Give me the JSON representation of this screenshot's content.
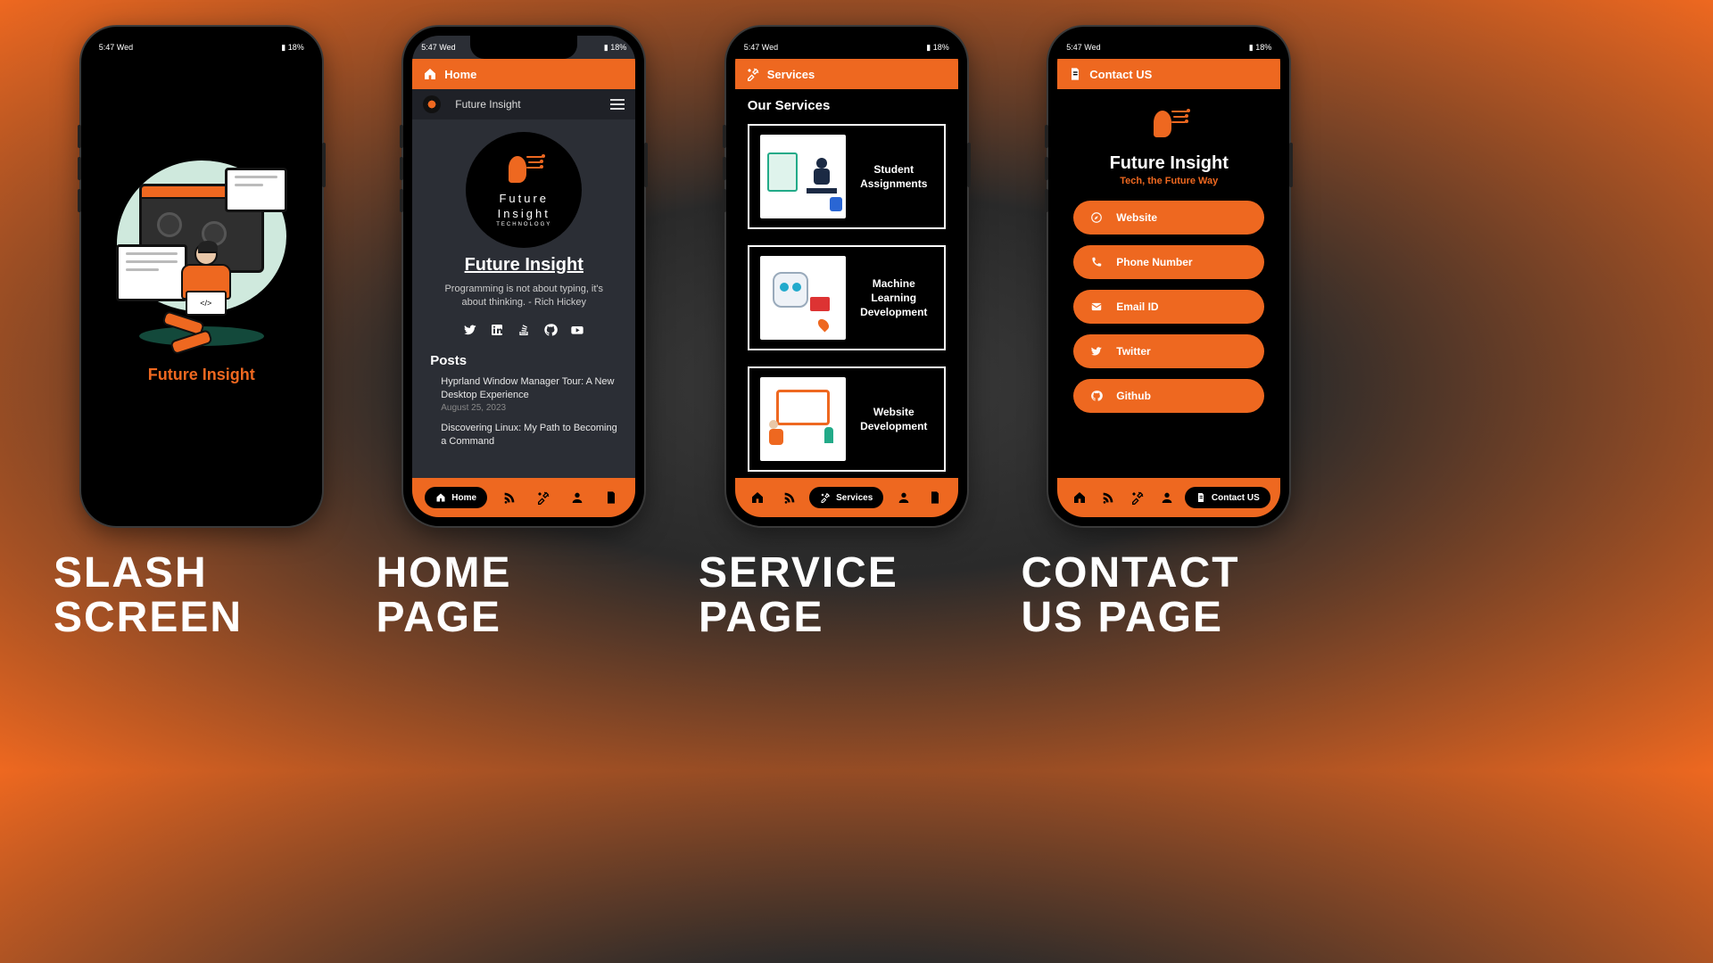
{
  "status": {
    "time": "5:47",
    "day": "Wed",
    "battery": "18%"
  },
  "captions": [
    "SLASH SCREEN",
    "HOME PAGE",
    "SERVICE PAGE",
    "CONTACT US PAGE"
  ],
  "splash": {
    "title": "Future Insight"
  },
  "home": {
    "appbar_label": "Home",
    "subheader_title": "Future Insight",
    "logo_line1": "Future",
    "logo_line2": "Insight",
    "logo_sub": "TECHNOLOGY",
    "title": "Future Insight",
    "quote": "Programming is not about typing, it's about thinking. - Rich Hickey",
    "posts_heading": "Posts",
    "posts": [
      {
        "title": "Hyprland Window Manager Tour: A New Desktop Experience",
        "date": "August 25, 2023"
      },
      {
        "title": "Discovering Linux: My Path to Becoming a Command",
        "date": ""
      }
    ],
    "nav": {
      "active": "Home",
      "items": [
        "Home",
        "Feed",
        "Services",
        "Profile",
        "Contact"
      ]
    }
  },
  "services": {
    "appbar_label": "Services",
    "heading": "Our Services",
    "cards": [
      {
        "label": "Student Assignments"
      },
      {
        "label": "Machine Learning Development"
      },
      {
        "label": "Website Development"
      }
    ],
    "nav_active": "Services"
  },
  "contact": {
    "appbar_label": "Contact US",
    "brand": "Future Insight",
    "tagline": "Tech, the Future Way",
    "buttons": [
      {
        "icon": "compass",
        "label": "Website"
      },
      {
        "icon": "phone",
        "label": "Phone Number"
      },
      {
        "icon": "mail",
        "label": "Email ID"
      },
      {
        "icon": "twitter",
        "label": "Twitter"
      },
      {
        "icon": "github",
        "label": "Github"
      }
    ],
    "nav_active": "Contact US"
  }
}
